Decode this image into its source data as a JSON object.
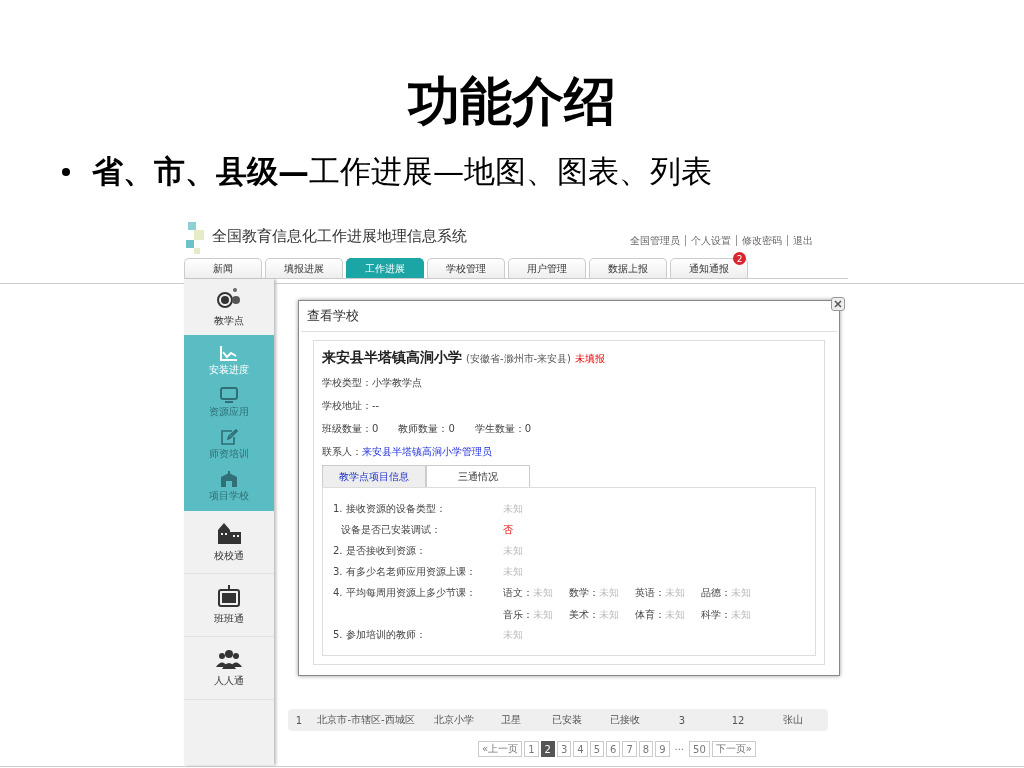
{
  "slide": {
    "title": "功能介绍",
    "bullet": {
      "lead": "省、市、县级—",
      "rest": "工作进展—地图、图表、列表"
    }
  },
  "app": {
    "title": "全国教育信息化工作进展地理信息系统",
    "user_links": [
      "全国管理员",
      "个人设置",
      "修改密码",
      "退出"
    ],
    "tabs": [
      {
        "label": "新闻",
        "selected": false
      },
      {
        "label": "填报进展",
        "selected": false
      },
      {
        "label": "工作进展",
        "selected": true
      },
      {
        "label": "学校管理",
        "selected": false
      },
      {
        "label": "用户管理",
        "selected": false
      },
      {
        "label": "数据上报",
        "selected": false
      },
      {
        "label": "通知通报",
        "selected": false,
        "badge": "2"
      }
    ],
    "sidebar": [
      {
        "label": "教学点",
        "expanded": true,
        "children": [
          {
            "label": "安装进度",
            "selected": true
          },
          {
            "label": "资源应用",
            "selected": false
          },
          {
            "label": "师资培训",
            "selected": false
          },
          {
            "label": "项目学校",
            "selected": false
          }
        ]
      },
      {
        "label": "校校通"
      },
      {
        "label": "班班通"
      },
      {
        "label": "人人通"
      }
    ],
    "table_row": [
      "1",
      "北京市-市辖区-西城区",
      "北京小学",
      "卫星",
      "已安装",
      "已接收",
      "3",
      "12",
      "张山"
    ],
    "pagination": [
      {
        "label": "«上一页",
        "selected": false
      },
      {
        "label": "1",
        "selected": false
      },
      {
        "label": "2",
        "selected": true
      },
      {
        "label": "3",
        "selected": false
      },
      {
        "label": "4",
        "selected": false
      },
      {
        "label": "5",
        "selected": false
      },
      {
        "label": "6",
        "selected": false
      },
      {
        "label": "7",
        "selected": false
      },
      {
        "label": "8",
        "selected": false
      },
      {
        "label": "9",
        "selected": false
      },
      {
        "label": "...",
        "kind": "gap"
      },
      {
        "label": "50",
        "selected": false
      },
      {
        "label": "下一页»",
        "selected": false
      }
    ],
    "dialog": {
      "title": "查看学校",
      "school": {
        "name": "来安县半塔镇高涧小学",
        "region": "(安徽省-滁州市-来安县)",
        "status": "未填报"
      },
      "fields": [
        {
          "label": "学校类型：",
          "value": "小学教学点"
        },
        {
          "label": "学校地址：",
          "value": "--"
        }
      ],
      "counts": [
        {
          "label": "班级数量：",
          "value": "0"
        },
        {
          "label": "教师数量：",
          "value": "0"
        },
        {
          "label": "学生数量：",
          "value": "0"
        }
      ],
      "contact": {
        "label": "联系人：",
        "value": "来安县半塔镇高涧小学管理员"
      },
      "tabs": [
        {
          "label": "教学点项目信息",
          "selected": true
        },
        {
          "label": "三通情况",
          "selected": false
        }
      ],
      "items": [
        {
          "label": "1. 接收资源的设备类型：",
          "value": "未知",
          "kind": "unknown"
        },
        {
          "label": "设备是否已安装调试：",
          "value": "否",
          "kind": "negative",
          "sub": true
        },
        {
          "label": "2. 是否接收到资源：",
          "value": "未知",
          "kind": "unknown"
        },
        {
          "label": "3. 有多少名老师应用资源上课：",
          "value": "未知",
          "kind": "unknown"
        },
        {
          "label": "4. 平均每周用资源上多少节课：",
          "kind": "subjects",
          "subjects": [
            {
              "name": "语文：",
              "value": "未知"
            },
            {
              "name": "数学：",
              "value": "未知"
            },
            {
              "name": "英语：",
              "value": "未知"
            },
            {
              "name": "品德：",
              "value": "未知"
            },
            {
              "name": "音乐：",
              "value": "未知"
            },
            {
              "name": "美术：",
              "value": "未知"
            },
            {
              "name": "体育：",
              "value": "未知"
            },
            {
              "name": "科学：",
              "value": "未知"
            }
          ]
        },
        {
          "label": "5. 参加培训的教师：",
          "value": "未知",
          "kind": "unknown"
        }
      ]
    }
  }
}
